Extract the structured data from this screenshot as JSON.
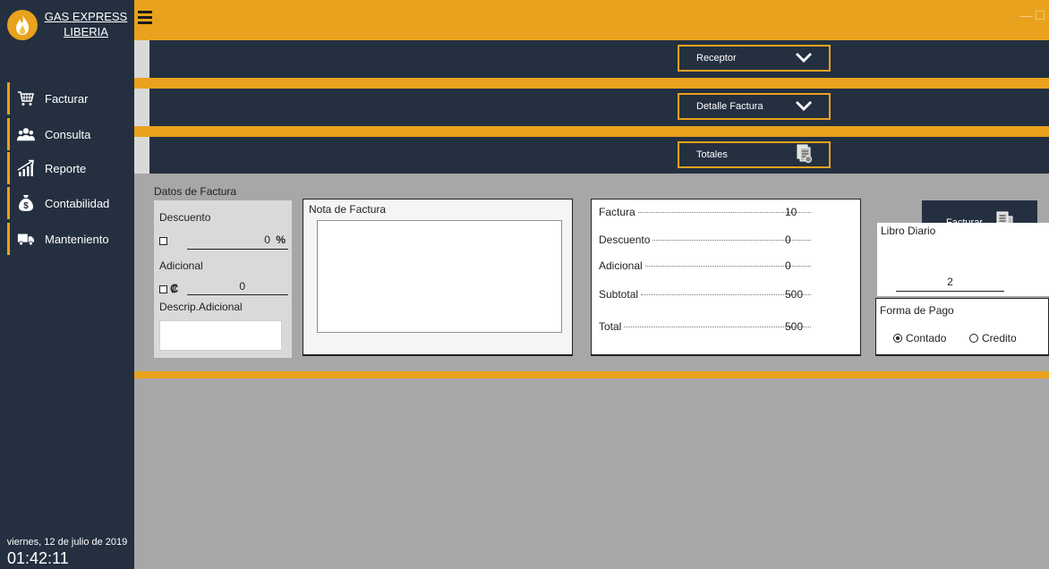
{
  "app": {
    "brand_line1": "GAS EXPRESS",
    "brand_line2": "LIBERIA"
  },
  "nav": [
    {
      "label": "Facturar",
      "icon": "cart-icon"
    },
    {
      "label": "Consulta",
      "icon": "users-icon"
    },
    {
      "label": "Reporte",
      "icon": "chart-icon"
    },
    {
      "label": "Contabilidad",
      "icon": "money-bag-icon"
    },
    {
      "label": "Manteniento",
      "icon": "truck-icon"
    }
  ],
  "status": {
    "date": "viernes, 12 de julio de 2019",
    "time": "01:42:11"
  },
  "sections": {
    "receptor": "Receptor",
    "detalle": "Detalle Factura",
    "totales": "Totales"
  },
  "datos": {
    "title": "Datos de Factura",
    "descuento_label": "Descuento",
    "descuento_value": "0",
    "descuento_unit": "%",
    "adicional_label": "Adicional",
    "adicional_symbol": "₡",
    "adicional_value": "0",
    "descrip_label": "Descrip.Adicional",
    "descrip_value": ""
  },
  "nota": {
    "title": "Nota de Factura",
    "value": ""
  },
  "totals": [
    {
      "label": "Factura",
      "value": "10"
    },
    {
      "label": "Descuento",
      "value": "0"
    },
    {
      "label": "Adicional",
      "value": "0"
    },
    {
      "label": "Subtotal",
      "value": "500"
    },
    {
      "label": "Total",
      "value": "500"
    }
  ],
  "facturar": {
    "label": "Facturar"
  },
  "libro": {
    "label": "Libro Diario",
    "value": "2"
  },
  "pago": {
    "label": "Forma de Pago",
    "options": [
      "Contado",
      "Credito"
    ],
    "selected": "Contado"
  },
  "colors": {
    "accent": "#e9a21d",
    "navy": "#243040",
    "content_bg": "#a7a7a7"
  }
}
